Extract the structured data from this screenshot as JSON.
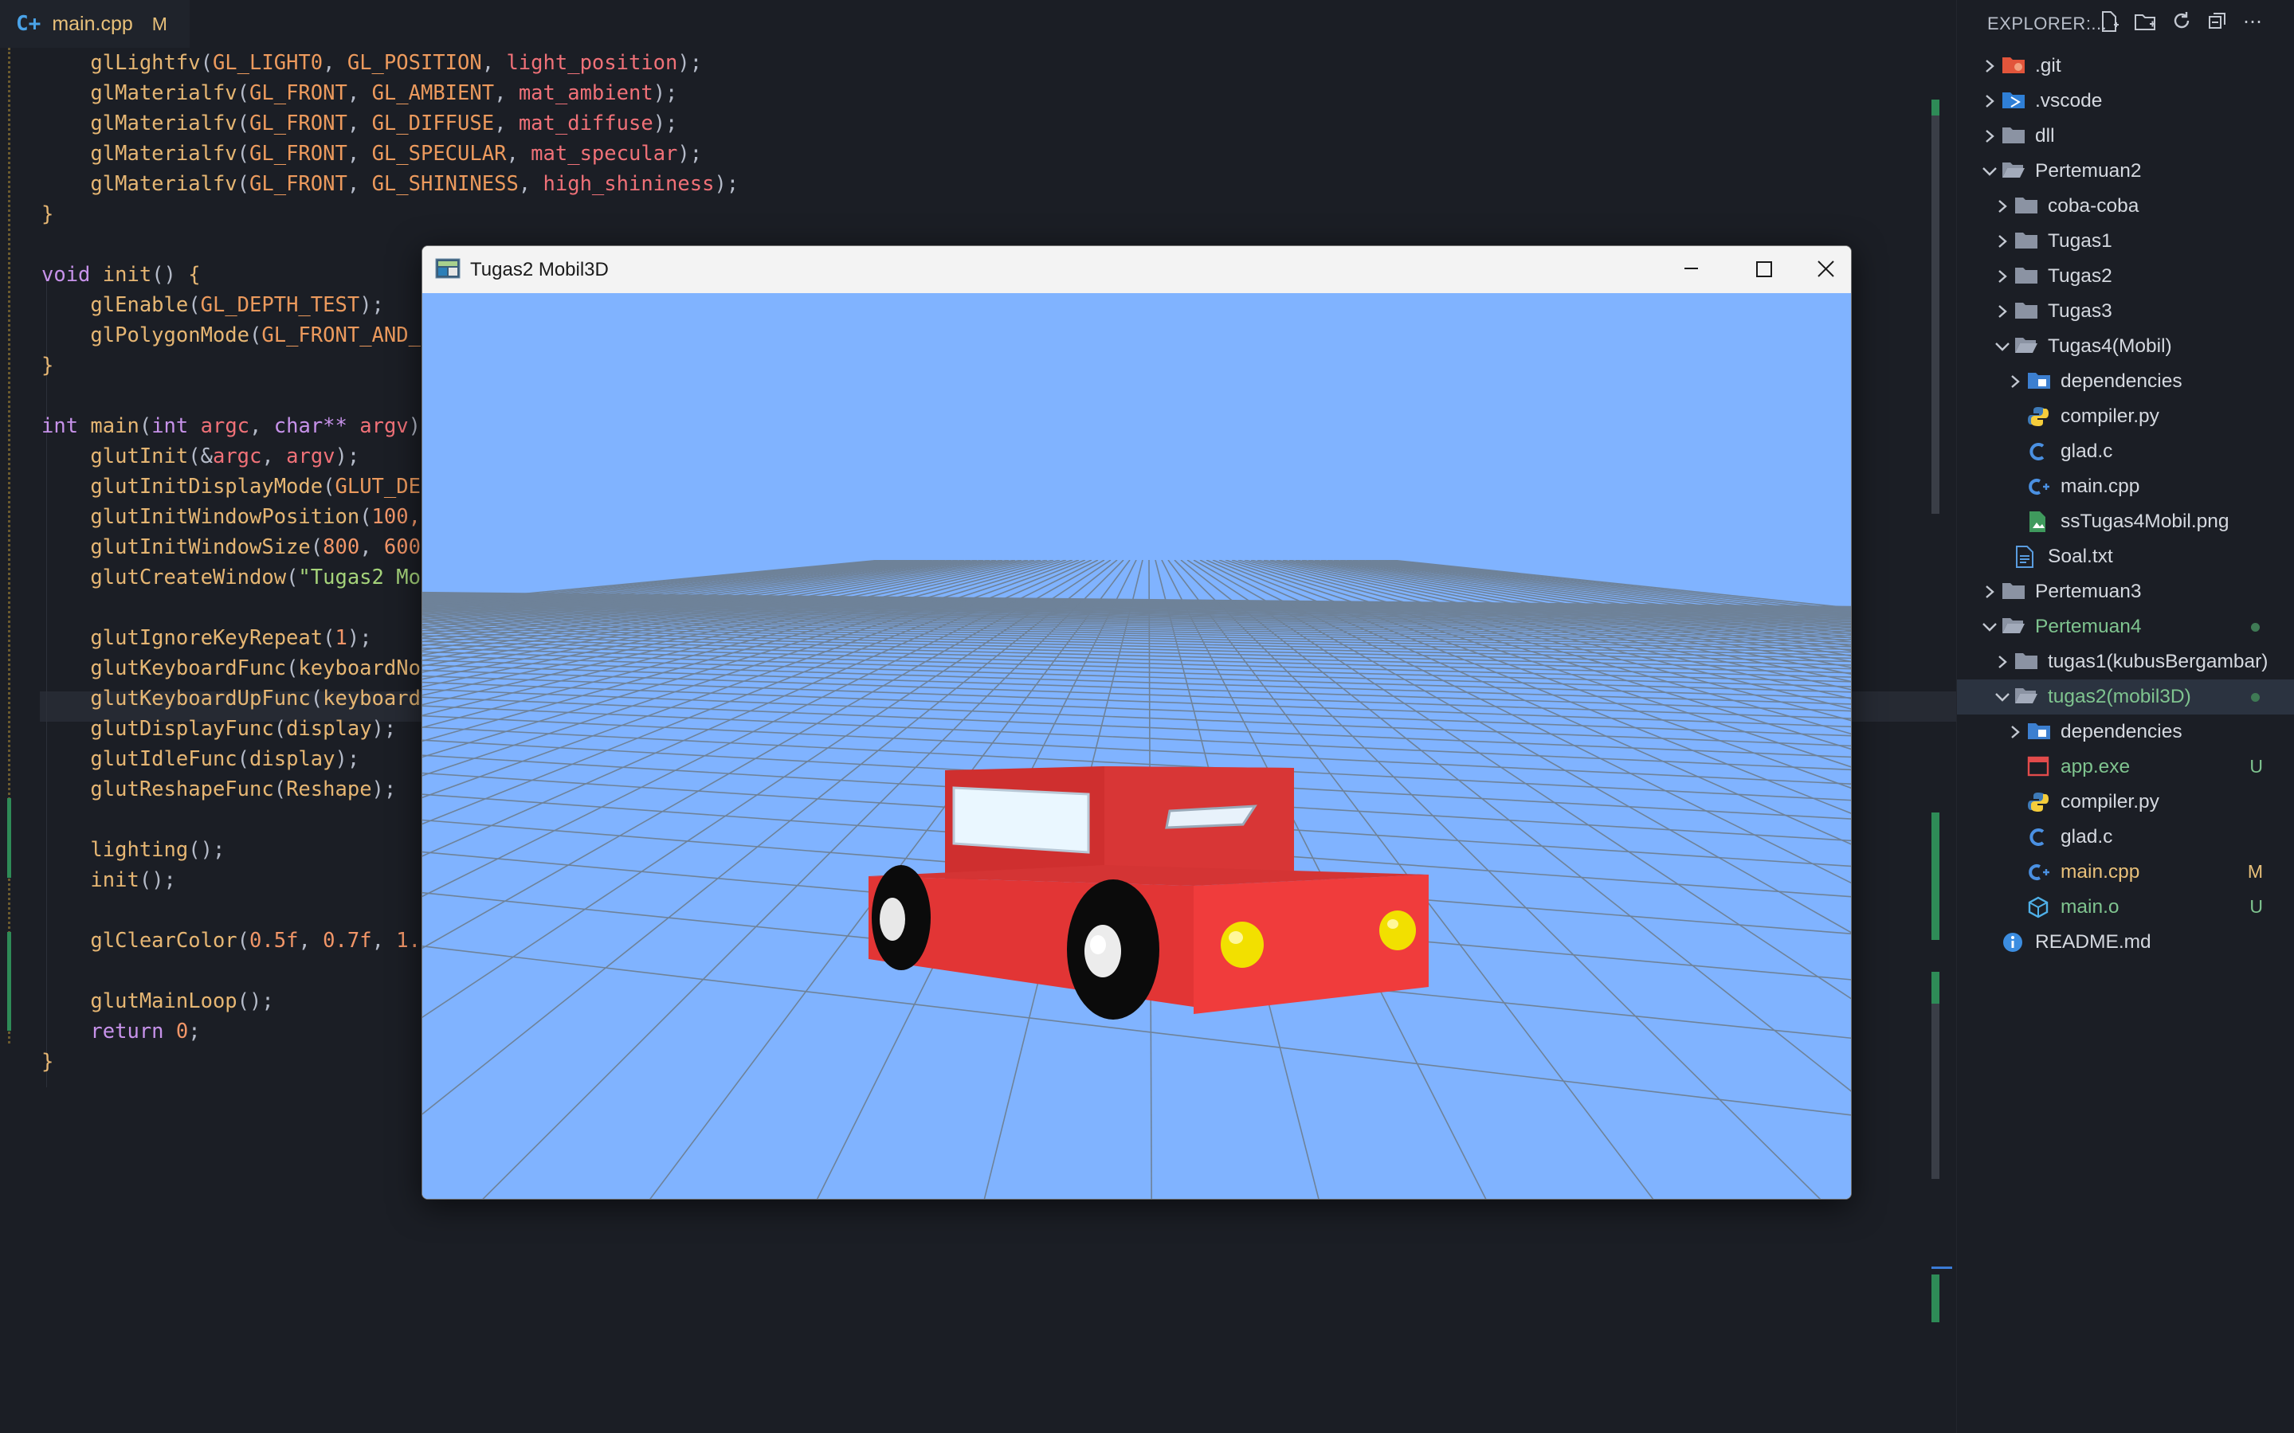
{
  "tab": {
    "filename": "main.cpp",
    "modified": "M",
    "icon": "C++"
  },
  "code": {
    "l1": [
      "glLightfv",
      "GL_LIGHT0",
      "GL_POSITION",
      "light_position"
    ],
    "l2": [
      "glMaterialfv",
      "GL_FRONT",
      "GL_AMBIENT",
      "mat_ambient"
    ],
    "l3": [
      "glMaterialfv",
      "GL_FRONT",
      "GL_DIFFUSE",
      "mat_diffuse"
    ],
    "l4": [
      "glMaterialfv",
      "GL_FRONT",
      "GL_SPECULAR",
      "mat_specular"
    ],
    "l5": [
      "glMaterialfv",
      "GL_FRONT",
      "GL_SHININESS",
      "high_shininess"
    ],
    "l8_kw": "void",
    "l8_fn": "init",
    "l9": [
      "glEnable",
      "GL_DEPTH_TEST"
    ],
    "l10": [
      "glPolygonMode",
      "GL_FRONT_AND_"
    ],
    "l13": {
      "kw1": "int",
      "fn": "main",
      "kw2": "int",
      "p1": "argc",
      "kw3": "char**",
      "p2": "argv"
    },
    "l14": [
      "glutInit",
      "argc",
      "argv"
    ],
    "l15": [
      "glutInitDisplayMode",
      "GLUT_DE"
    ],
    "l16": [
      "glutInitWindowPosition",
      "100,"
    ],
    "l17": [
      "glutInitWindowSize",
      "800",
      "600"
    ],
    "l18": [
      "glutCreateWindow",
      "\"Tugas2 Mo"
    ],
    "l20": [
      "glutIgnoreKeyRepeat",
      "1"
    ],
    "l21": [
      "glutKeyboardFunc",
      "keyboardNo"
    ],
    "l22": [
      "glutKeyboardUpFunc",
      "keyboard"
    ],
    "l23": [
      "glutDisplayFunc",
      "display"
    ],
    "l24": [
      "glutIdleFunc",
      "display"
    ],
    "l25": [
      "glutReshapeFunc",
      "Reshape"
    ],
    "l27": "lighting",
    "l28": "init",
    "l30": [
      "glClearColor",
      "0.5f",
      "0.7f",
      "1."
    ],
    "l32": "glutMainLoop",
    "l33": [
      "return",
      "0"
    ]
  },
  "explorer": {
    "title": "EXPLORER:...",
    "items": [
      {
        "label": ".git",
        "depth": 0,
        "kind": "folder-git",
        "chev": "right"
      },
      {
        "label": ".vscode",
        "depth": 0,
        "kind": "folder-vscode",
        "chev": "right"
      },
      {
        "label": "dll",
        "depth": 0,
        "kind": "folder",
        "chev": "right"
      },
      {
        "label": "Pertemuan2",
        "depth": 0,
        "kind": "folder-open",
        "chev": "down"
      },
      {
        "label": "coba-coba",
        "depth": 1,
        "kind": "folder",
        "chev": "right"
      },
      {
        "label": "Tugas1",
        "depth": 1,
        "kind": "folder",
        "chev": "right"
      },
      {
        "label": "Tugas2",
        "depth": 1,
        "kind": "folder",
        "chev": "right"
      },
      {
        "label": "Tugas3",
        "depth": 1,
        "kind": "folder",
        "chev": "right"
      },
      {
        "label": "Tugas4(Mobil)",
        "depth": 1,
        "kind": "folder-open",
        "chev": "down"
      },
      {
        "label": "dependencies",
        "depth": 2,
        "kind": "folder-blue",
        "chev": "right"
      },
      {
        "label": "compiler.py",
        "depth": 2,
        "kind": "py"
      },
      {
        "label": "glad.c",
        "depth": 2,
        "kind": "c"
      },
      {
        "label": "main.cpp",
        "depth": 2,
        "kind": "cpp"
      },
      {
        "label": "ssTugas4Mobil.png",
        "depth": 2,
        "kind": "png"
      },
      {
        "label": "Soal.txt",
        "depth": 1,
        "kind": "txt"
      },
      {
        "label": "Pertemuan3",
        "depth": 0,
        "kind": "folder",
        "chev": "right"
      },
      {
        "label": "Pertemuan4",
        "depth": 0,
        "kind": "folder-open",
        "chev": "down",
        "color": "#7fc48f",
        "dot": true
      },
      {
        "label": "tugas1(kubusBergambar)",
        "depth": 1,
        "kind": "folder",
        "chev": "right"
      },
      {
        "label": "tugas2(mobil3D)",
        "depth": 1,
        "kind": "folder-open",
        "chev": "down",
        "color": "#7fc48f",
        "dot": true,
        "selected": true
      },
      {
        "label": "dependencies",
        "depth": 2,
        "kind": "folder-blue",
        "chev": "right"
      },
      {
        "label": "app.exe",
        "depth": 2,
        "kind": "exe",
        "color": "#7fc48f",
        "badge": "U",
        "badgeColor": "#7fc48f"
      },
      {
        "label": "compiler.py",
        "depth": 2,
        "kind": "py"
      },
      {
        "label": "glad.c",
        "depth": 2,
        "kind": "c"
      },
      {
        "label": "main.cpp",
        "depth": 2,
        "kind": "cpp",
        "color": "#e8c07a",
        "badge": "M",
        "badgeColor": "#e8c07a"
      },
      {
        "label": "main.o",
        "depth": 2,
        "kind": "obj",
        "color": "#7fc48f",
        "badge": "U",
        "badgeColor": "#7fc48f"
      },
      {
        "label": "README.md",
        "depth": 0,
        "kind": "info"
      }
    ]
  },
  "window": {
    "title": "Tugas2 Mobil3D",
    "sky_color": "#80b3ff",
    "car_color": "#ef3b3b"
  },
  "colors": {
    "accent_green": "#7fc48f",
    "modified": "#e8c07a",
    "editor_bg": "#1b1e25"
  }
}
